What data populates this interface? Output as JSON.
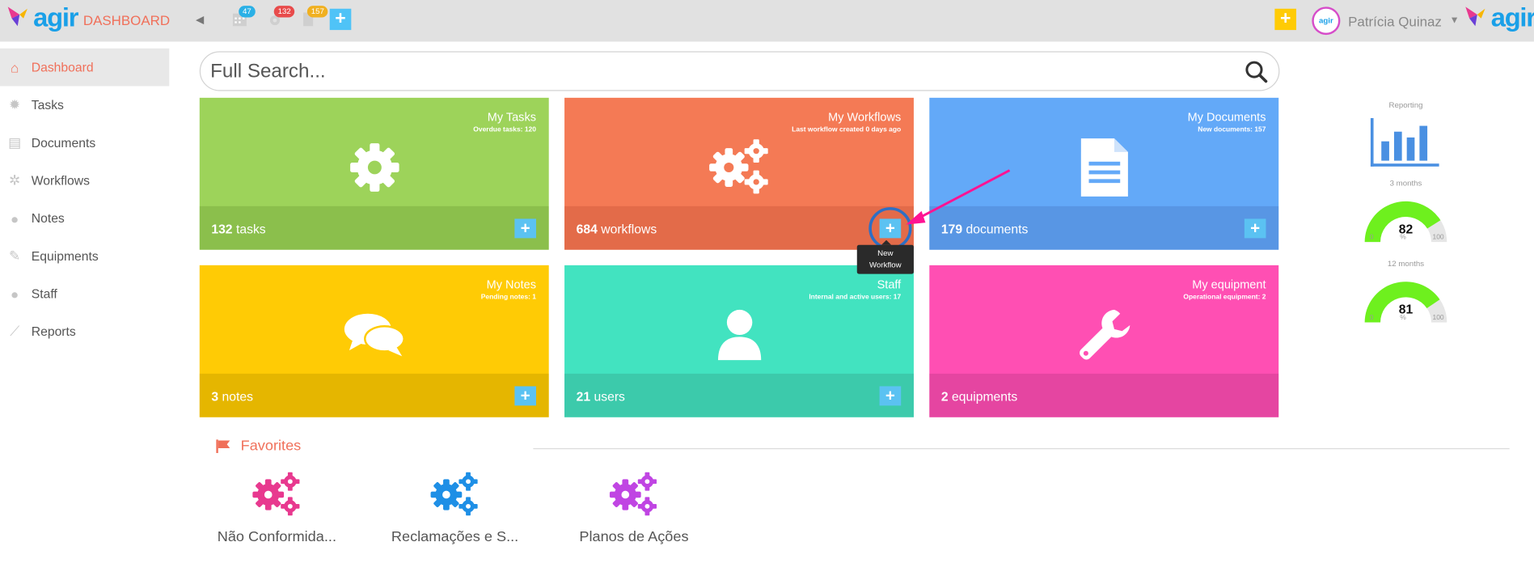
{
  "app": {
    "logo_text": "agir",
    "title": "DASHBOARD"
  },
  "topbar": {
    "calendar_badge": "47",
    "workflows_badge": "132",
    "documents_badge": "157",
    "user_name": "Patrícia Quinaz",
    "avatar_text": "agir"
  },
  "sidebar": {
    "items": [
      {
        "label": "Dashboard",
        "icon": "home-icon"
      },
      {
        "label": "Tasks",
        "icon": "gear-icon"
      },
      {
        "label": "Documents",
        "icon": "document-icon"
      },
      {
        "label": "Workflows",
        "icon": "gears-icon"
      },
      {
        "label": "Notes",
        "icon": "chat-icon"
      },
      {
        "label": "Equipments",
        "icon": "wrench-icon"
      },
      {
        "label": "Staff",
        "icon": "user-icon"
      },
      {
        "label": "Reports",
        "icon": "line-chart-icon"
      }
    ]
  },
  "search": {
    "placeholder": "Full Search..."
  },
  "cards": {
    "tasks": {
      "title": "My Tasks",
      "subtitle": "Overdue tasks: 120",
      "count": "132",
      "unit": "tasks",
      "color": "#9dd35a"
    },
    "workflows": {
      "title": "My Workflows",
      "subtitle": "Last workflow created 0 days ago",
      "count": "684",
      "unit": "workflows",
      "color": "#f47a55"
    },
    "documents": {
      "title": "My Documents",
      "subtitle": "New documents: 157",
      "count": "179",
      "unit": "documents",
      "color": "#63a9f8"
    },
    "notes": {
      "title": "My Notes",
      "subtitle": "Pending notes: 1",
      "count": "3",
      "unit": "notes",
      "color": "#ffcb05"
    },
    "staff": {
      "title": "Staff",
      "subtitle": "Internal and active users: 17",
      "count": "21",
      "unit": "users",
      "color": "#42e3c0"
    },
    "equipment": {
      "title": "My equipment",
      "subtitle": "Operational equipment: 2",
      "count": "2",
      "unit": "equipments",
      "color": "#ff4fb3"
    }
  },
  "tooltip": {
    "line1": "New",
    "line2": "Workflow"
  },
  "favorites": {
    "heading": "Favorites",
    "items": [
      {
        "label": "Não Conformida...",
        "color": "#e8398f"
      },
      {
        "label": "Reclamações e S...",
        "color": "#1e8fe6"
      },
      {
        "label": "Planos de Ações",
        "color": "#c045e3"
      }
    ]
  },
  "reporting": {
    "title": "Reporting",
    "gauges": [
      {
        "label": "3 months",
        "value": 82,
        "min": "0",
        "max": "100",
        "unit": "%"
      },
      {
        "label": "12 months",
        "value": 81,
        "min": "0",
        "max": "100",
        "unit": "%"
      }
    ]
  }
}
